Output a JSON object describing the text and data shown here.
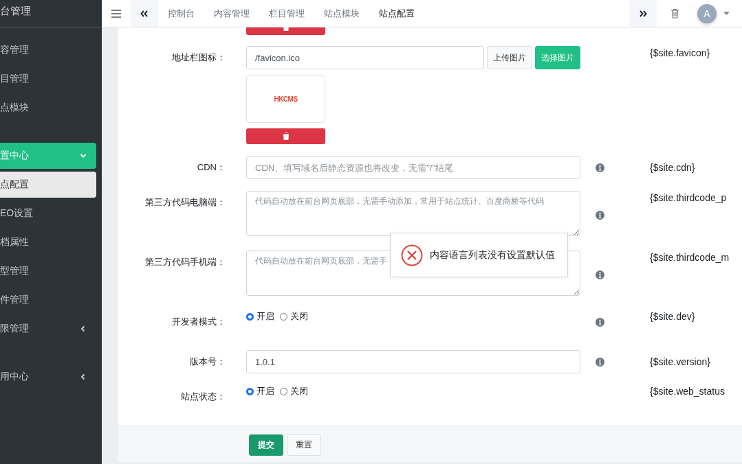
{
  "sidebar": {
    "title": "台管理",
    "items": [
      {
        "label": "容管理",
        "kind": "link"
      },
      {
        "label": "目管理",
        "kind": "link"
      },
      {
        "label": "点模块",
        "kind": "link"
      },
      {
        "label": "置中心",
        "kind": "group",
        "expanded": true,
        "children": [
          {
            "label": "点配置",
            "kind": "link",
            "selected": true
          },
          {
            "label": "EO设置",
            "kind": "link",
            "selected": false
          },
          {
            "label": "档属性",
            "kind": "link",
            "selected": false
          },
          {
            "label": "型管理",
            "kind": "link",
            "selected": false
          },
          {
            "label": "件管理",
            "kind": "link",
            "selected": false
          },
          {
            "label": "限管理",
            "kind": "group",
            "expanded": false,
            "selected": false
          }
        ]
      },
      {
        "label": "用中心",
        "kind": "group",
        "expanded": false
      }
    ]
  },
  "topbar": {
    "tabs": [
      {
        "label": "控制台",
        "selected": false
      },
      {
        "label": "内容管理",
        "selected": false
      },
      {
        "label": "栏目管理",
        "selected": false
      },
      {
        "label": "站点模块",
        "selected": false
      },
      {
        "label": "站点配置",
        "selected": true
      }
    ],
    "avatar": "A"
  },
  "form": {
    "fields": [
      {
        "kind": "image",
        "label": "地址栏图标：",
        "value": "/favicon.ico",
        "upload_button": "上传图片",
        "choose_button": "选择图片",
        "preview_logo": "HKCMS",
        "info": false,
        "variable": "{$site.favicon}"
      },
      {
        "kind": "text",
        "label": "CDN：",
        "placeholder": "CDN、填写域名后静态资源也将改变，无需\"/\"结尾",
        "info": true,
        "variable": "{$site.cdn}"
      },
      {
        "kind": "textarea",
        "label": "第三方代码电脑端：",
        "placeholder": "代码自动放在前台网页底部，无需手动添加，常用于站点统计、百度商桥等代码",
        "info": true,
        "variable": "{$site.thirdcode_p"
      },
      {
        "kind": "textarea",
        "label": "第三方代码手机端：",
        "placeholder": "代码自动放在前台网页底部，无需手",
        "info": true,
        "variable": "{$site.thirdcode_m"
      },
      {
        "kind": "radio",
        "label": "开发者模式：",
        "options": [
          {
            "label": "开启",
            "selected": true
          },
          {
            "label": "关闭",
            "selected": false
          }
        ],
        "info": true,
        "variable": "{$site.dev}"
      },
      {
        "kind": "text",
        "label": "版本号：",
        "value": "1.0.1",
        "info": true,
        "variable": "{$site.version}"
      },
      {
        "kind": "radio",
        "label": "站点状态：",
        "options": [
          {
            "label": "开启",
            "selected": true
          },
          {
            "label": "关闭",
            "selected": false
          }
        ],
        "info": false,
        "variable": "{$site.web_status"
      }
    ],
    "submit": "提交",
    "reset": "重置"
  },
  "toast": {
    "message": "内容语言列表没有设置默认值"
  }
}
